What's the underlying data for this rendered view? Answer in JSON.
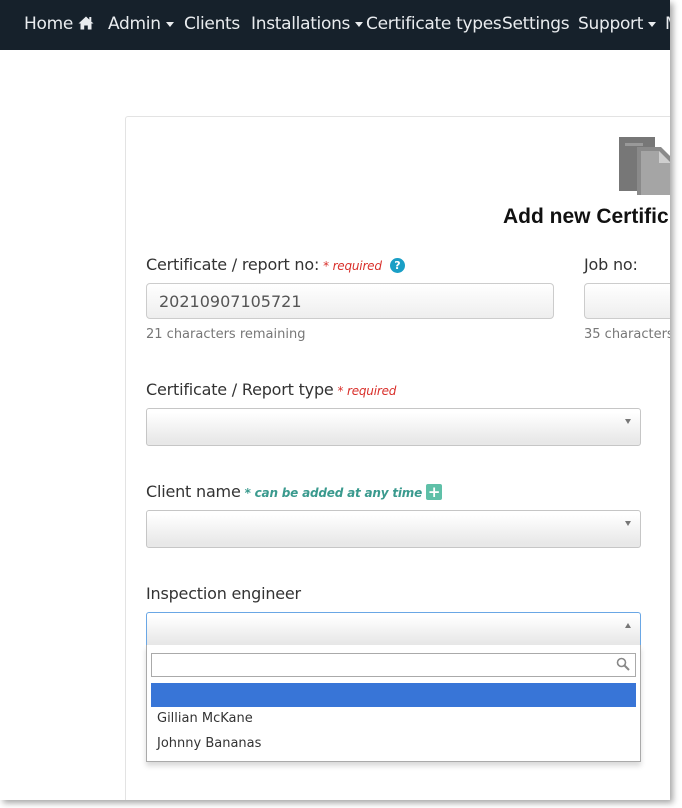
{
  "nav": {
    "home": "Home",
    "admin": "Admin",
    "clients": "Clients",
    "installations": "Installations",
    "certificate_types": "Certificate types",
    "settings": "Settings",
    "support": "Support",
    "more_cut": "M"
  },
  "page": {
    "title": "Add new Certific"
  },
  "form": {
    "cert_no": {
      "label": "Certificate / report no:",
      "required": "* required",
      "value": "20210907105721",
      "hint": "21 characters remaining"
    },
    "job_no": {
      "label": "Job no:",
      "value": "",
      "hint": "35 characters"
    },
    "cert_type": {
      "label": "Certificate / Report type",
      "required": "* required",
      "selected": ""
    },
    "client": {
      "label": "Client name",
      "note": "* can be added at any time",
      "selected": ""
    },
    "engineer": {
      "label": "Inspection engineer",
      "selected": "",
      "search_value": "",
      "options": [
        "",
        "Gillian McKane",
        "Johnny Bananas"
      ]
    }
  },
  "colors": {
    "navbar": "#16212b",
    "required": "#d9302b",
    "note_green": "#3a9a8e",
    "help_blue": "#1a9fc6",
    "highlight": "#3875d7"
  },
  "icons": {
    "home": "home-icon",
    "help": "question-circle-icon",
    "add": "plus-square-icon",
    "document": "document-icon",
    "search": "search-icon"
  }
}
